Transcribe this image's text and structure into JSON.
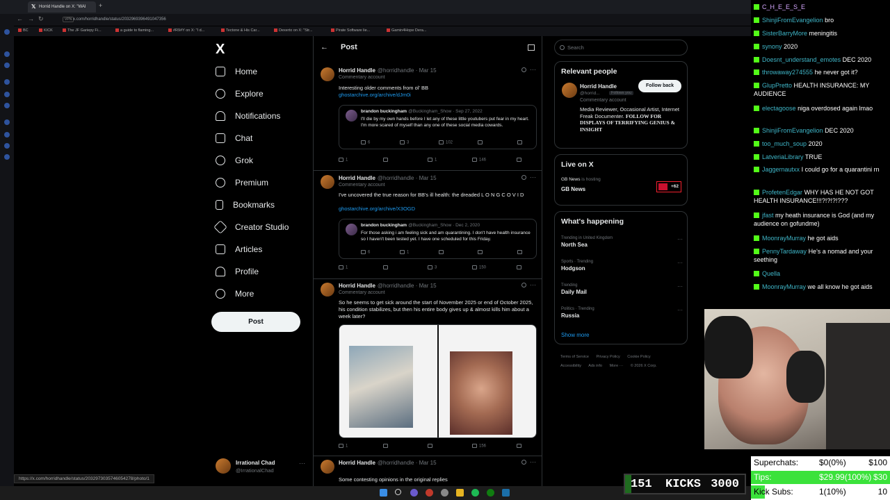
{
  "browser": {
    "tab_title": "Horrid Handle on X: \"WAI",
    "url": "x.com/horridhandle/status/2032969396491047356",
    "vpn": "VPN",
    "bookmarks": [
      "BC",
      "KICK",
      "The JF Gariepy Fi...",
      "a guide to flaming...",
      "#R9#Y on X: \"I d...",
      "Tectone & His Car...",
      "Dexerto on X: \"Str...",
      "Pirate Software lie...",
      "Gamin4Hope Dera..."
    ],
    "status_link": "https://x.com/horridhandle/status/2032973035746054278/photo/1"
  },
  "nav": {
    "logo": "X",
    "items": [
      {
        "label": "Home",
        "icon": "home-icon"
      },
      {
        "label": "Explore",
        "icon": "search-icon"
      },
      {
        "label": "Notifications",
        "icon": "bell-icon"
      },
      {
        "label": "Chat",
        "icon": "mail-icon"
      },
      {
        "label": "Grok",
        "icon": "grok-icon"
      },
      {
        "label": "Premium",
        "icon": "premium-icon"
      },
      {
        "label": "Bookmarks",
        "icon": "bookmark-icon"
      },
      {
        "label": "Creator Studio",
        "icon": "rocket-icon"
      },
      {
        "label": "Articles",
        "icon": "article-icon"
      },
      {
        "label": "Profile",
        "icon": "person-icon"
      },
      {
        "label": "More",
        "icon": "more-circle-icon"
      }
    ],
    "post_button": "Post",
    "account": {
      "name": "Irrational Chad",
      "handle": "@IrrationalChad"
    }
  },
  "main": {
    "header": "Post",
    "tweets": [
      {
        "name": "Horrid Handle",
        "meta": "@horridhandle · Mar 15",
        "tag": "Commentary account",
        "text": "Interesting older comments from ol' BB",
        "link": "ghostarchive.org/archive/dJm0i",
        "quote": {
          "name": "brandon buckingham",
          "meta": "@Buckingham_Show · Sep 27, 2022",
          "text": "I'll die by my own hands before I let any of these little youtubers put fear in my heart. I'm more scared of myself than any one of these social media cowards.",
          "actions": [
            "6",
            "3",
            "102",
            ""
          ]
        },
        "actions": [
          "1",
          "",
          "1",
          "146"
        ]
      },
      {
        "name": "Horrid Handle",
        "meta": "@horridhandle · Mar 15",
        "tag": "Commentary account",
        "text": "I've uncovered the true reason for BB's ill health: the dreaded L O N G  C O V I D",
        "link": "ghostarchive.org/archive/X3OGD",
        "quote": {
          "name": "brandon buckingham",
          "meta": "@Buckingham_Show · Dec 2, 2020",
          "text": "For those asking i am feeling sick and am quarantining. I don't have health insurance so I haven't been tested yet. I have one scheduled for this Friday.",
          "actions": [
            "6",
            "1",
            "",
            ""
          ]
        },
        "actions": [
          "1",
          "",
          "3",
          "150"
        ]
      },
      {
        "name": "Horrid Handle",
        "meta": "@horridhandle · Mar 15",
        "tag": "Commentary account",
        "text": "So he seems to get sick around the start of November 2025 or end of October 2025, his condition stabilizes, but then his entire body gives up & almost kills him about a week later?",
        "link": "",
        "actions": [
          "1",
          "",
          "",
          "156"
        ]
      },
      {
        "name": "Horrid Handle",
        "meta": "@horridhandle · Mar 15",
        "tag": "",
        "text": "Some contesting opinions in the original replies",
        "link": "",
        "actions": []
      }
    ]
  },
  "right": {
    "search_placeholder": "Search",
    "relevant": {
      "title": "Relevant people",
      "name": "Horrid Handle",
      "handle": "@horrid...",
      "follows_you": "Follows you",
      "tag": "Commentary account",
      "bio": "Media Reviewer, Occasional Artist, Internet Freak Documenter.",
      "bio_bold": "FOLLOW FOR DISPLAYS OF TERRIFYING GENIUS & INSIGHT",
      "follow_button": "Follow back"
    },
    "live": {
      "title": "Live on X",
      "source": "GB News",
      "hosting": "is hosting",
      "show": "GB News",
      "count": "+62"
    },
    "happening": {
      "title": "What's happening",
      "trends": [
        {
          "context": "Trending in United Kingdom",
          "title": "North Sea"
        },
        {
          "context": "Sports · Trending",
          "title": "Hodgson"
        },
        {
          "context": "Trending",
          "title": "Daily Mail"
        },
        {
          "context": "Politics · Trending",
          "title": "Russia"
        }
      ],
      "show_more": "Show more"
    },
    "footer": [
      "Terms of Service",
      "Privacy Policy",
      "Cookie Policy",
      "Accessibility",
      "Ads info",
      "More ···",
      "© 2026 X Corp."
    ]
  },
  "chat": {
    "lines": [
      {
        "user": "C_H_E_E_S_E",
        "msg": "",
        "color": "#d6a8ff"
      },
      {
        "user": "ShinjiFromEvangelion",
        "msg": "bro",
        "color": "#3fb6c8"
      },
      {
        "user": "SisterBarryMore",
        "msg": "meningitis",
        "color": "#3fb6c8"
      },
      {
        "user": "synony",
        "msg": "2020",
        "color": "#3fb6c8"
      },
      {
        "user": "Doesnt_understand_emotes",
        "msg": "DEC 2020",
        "color": "#3fb6c8"
      },
      {
        "user": "throwaway274555",
        "msg": "he never got it?",
        "color": "#3fb6c8"
      },
      {
        "user": "GlupPretto",
        "msg": "HEALTH INSURANCE: MY AUDIENCE",
        "color": "#3fb6c8"
      },
      {
        "user": "electagoose",
        "msg": "niga overdosed again lmao",
        "color": "#3fb6c8"
      },
      {
        "user": "ShinjiFromEvangelion",
        "msg": "DEC 2020",
        "color": "#3fb6c8"
      },
      {
        "user": "too_much_soup",
        "msg": "2020",
        "color": "#3fb6c8"
      },
      {
        "user": "LatveriaLibrary",
        "msg": "TRUE",
        "color": "#3fb6c8"
      },
      {
        "user": "Jaggernautxx",
        "msg": "I could go for a quarantini rn",
        "color": "#3fb6c8"
      },
      {
        "user": "ProfetenEdgar",
        "msg": "WHY HAS HE NOT GOT HEALTH INSURANCE!!!?!?!?!???",
        "color": "#3fb6c8"
      },
      {
        "user": "jfast",
        "msg": "my heath insurance is God (and my audience on gofundme)",
        "color": "#3fb6c8"
      },
      {
        "user": "MoonrayMurray",
        "msg": "he got aids",
        "color": "#3fb6c8"
      },
      {
        "user": "PennyTardaway",
        "msg": "He's a nomad and your seething",
        "color": "#3fb6c8"
      },
      {
        "user": "Quella",
        "msg": "",
        "color": "#3fb6c8"
      },
      {
        "user": "MoonrayMurray",
        "msg": "we all know he got aids",
        "color": "#3fb6c8"
      }
    ]
  },
  "overlay": {
    "kicks": {
      "current": "151",
      "label": "KICKS",
      "goal": "3000",
      "fraction": 0.05
    },
    "goals": [
      {
        "label": "Superchats:",
        "value": "$0(0%)",
        "target": "$100",
        "fraction": 0
      },
      {
        "label": "Tips:",
        "value": "$29.99(100%)",
        "target": "$30",
        "fraction": 1
      },
      {
        "label": "Kick Subs:",
        "value": "1(10%)",
        "target": "10",
        "fraction": 0.1
      }
    ]
  },
  "colors": {
    "accent": "#1d9bf0",
    "kick_green": "#53fc18",
    "bg": "#000000"
  }
}
